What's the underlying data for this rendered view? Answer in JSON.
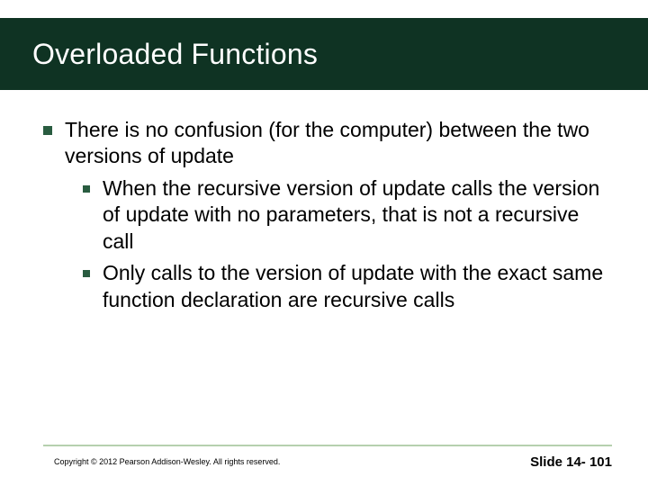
{
  "title": "Overloaded Functions",
  "bullets": {
    "main": "There is no confusion (for the computer) between the two versions of update",
    "sub1": "When the recursive version of update calls the version of update with no parameters, that is not a recursive call",
    "sub2": "Only calls to the version of update with the exact same function declaration are recursive calls"
  },
  "footer": {
    "copyright": "Copyright © 2012 Pearson Addison-Wesley.  All rights reserved.",
    "slide_number": "Slide 14- 101"
  }
}
